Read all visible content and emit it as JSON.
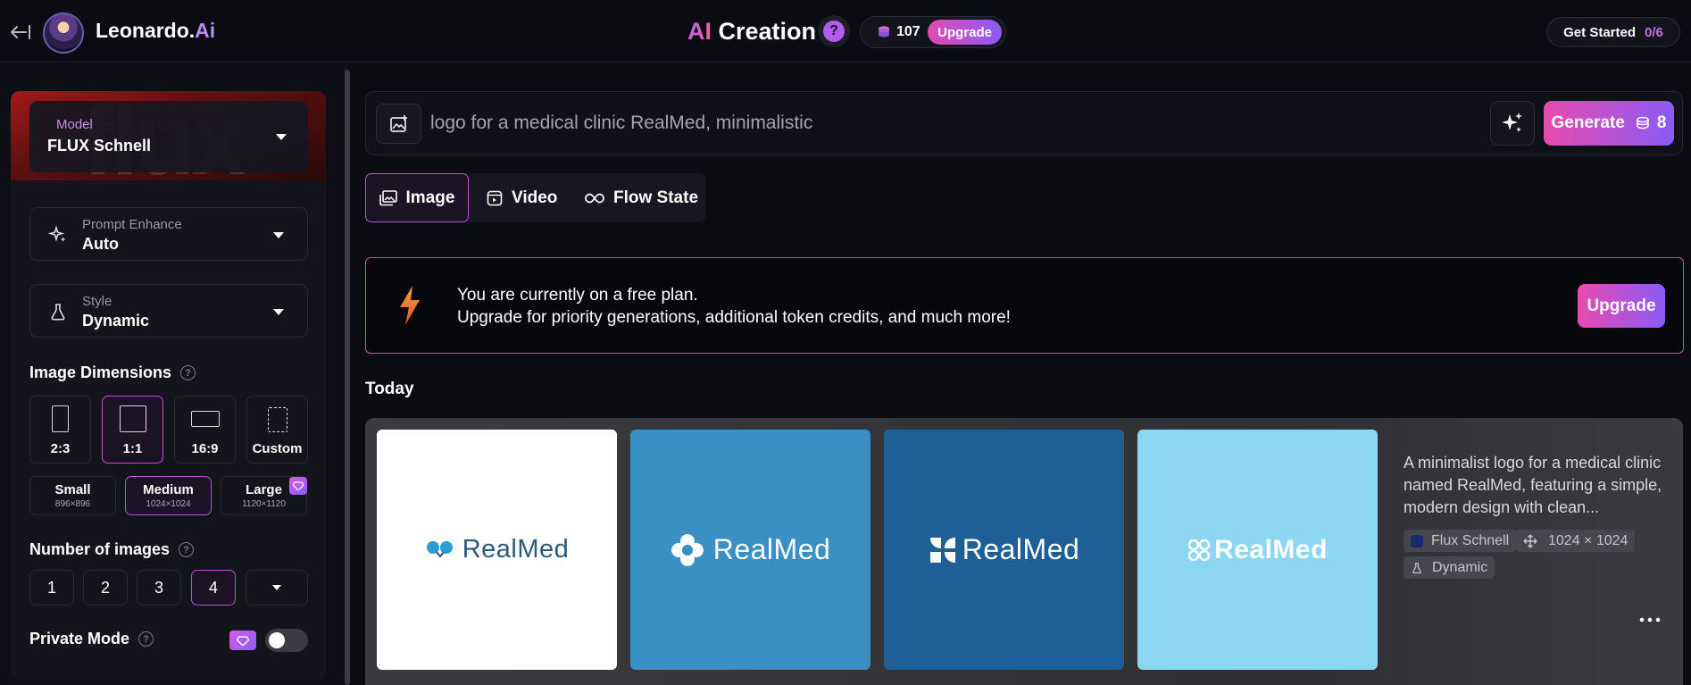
{
  "header": {
    "brand_name": "Leonardo.",
    "brand_suffix": "Ai",
    "title_prefix": "AI",
    "title_main": "Creation",
    "help_label": "?",
    "tokens": "107",
    "upgrade_label": "Upgrade",
    "get_started_label": "Get Started",
    "get_started_progress": "0/6"
  },
  "sidebar": {
    "model": {
      "label": "Model",
      "value": "FLUX Schnell",
      "bg_word": "flux"
    },
    "prompt_enhance": {
      "label": "Prompt Enhance",
      "value": "Auto"
    },
    "style": {
      "label": "Style",
      "value": "Dynamic"
    },
    "image_dimensions": {
      "title": "Image Dimensions",
      "ratios": [
        {
          "label": "2:3",
          "active": false
        },
        {
          "label": "1:1",
          "active": true
        },
        {
          "label": "16:9",
          "active": false
        },
        {
          "label": "Custom",
          "active": false
        }
      ],
      "sizes": [
        {
          "name": "Small",
          "px": "896×896",
          "active": false
        },
        {
          "name": "Medium",
          "px": "1024×1024",
          "active": true
        },
        {
          "name": "Large",
          "px": "1120×1120",
          "active": false,
          "premium": true
        }
      ]
    },
    "number_of_images": {
      "title": "Number of images",
      "options": [
        "1",
        "2",
        "3",
        "4"
      ],
      "selected": "4"
    },
    "private_mode": {
      "title": "Private Mode",
      "enabled": false
    }
  },
  "prompt": {
    "value": "logo for a medical clinic RealMed, minimalistic",
    "generate_label": "Generate",
    "generate_cost": "8"
  },
  "tabs": [
    {
      "label": "Image",
      "icon": "image-icon",
      "active": true
    },
    {
      "label": "Video",
      "icon": "video-icon",
      "active": false
    },
    {
      "label": "Flow State",
      "icon": "infinity-icon",
      "active": false
    }
  ],
  "banner": {
    "line1": "You are currently on a free plan.",
    "line2": "Upgrade for priority generations, additional token credits, and much more!",
    "button_label": "Upgrade"
  },
  "feed": {
    "section_label": "Today",
    "generation": {
      "description": "A minimalist logo for a medical clinic named RealMed, featuring a simple, modern design with clean...",
      "model": "Flux Schnell",
      "dimensions": "1024 × 1024",
      "style": "Dynamic",
      "images": [
        {
          "text": "RealMed",
          "bg": "#ffffff",
          "fg": "#2b5a7f"
        },
        {
          "text": "RealMed",
          "bg": "#3a8fc4",
          "fg": "#ffffff"
        },
        {
          "text": "RealMed",
          "bg": "#1f5f98",
          "fg": "#ffffff"
        },
        {
          "text": "RealMed",
          "bg": "#8dd6f2",
          "fg": "#ffffff"
        }
      ]
    }
  },
  "colors": {
    "accent": "#c04fd8",
    "gradient_start": "#e84aae",
    "gradient_end": "#8a5cf6"
  }
}
